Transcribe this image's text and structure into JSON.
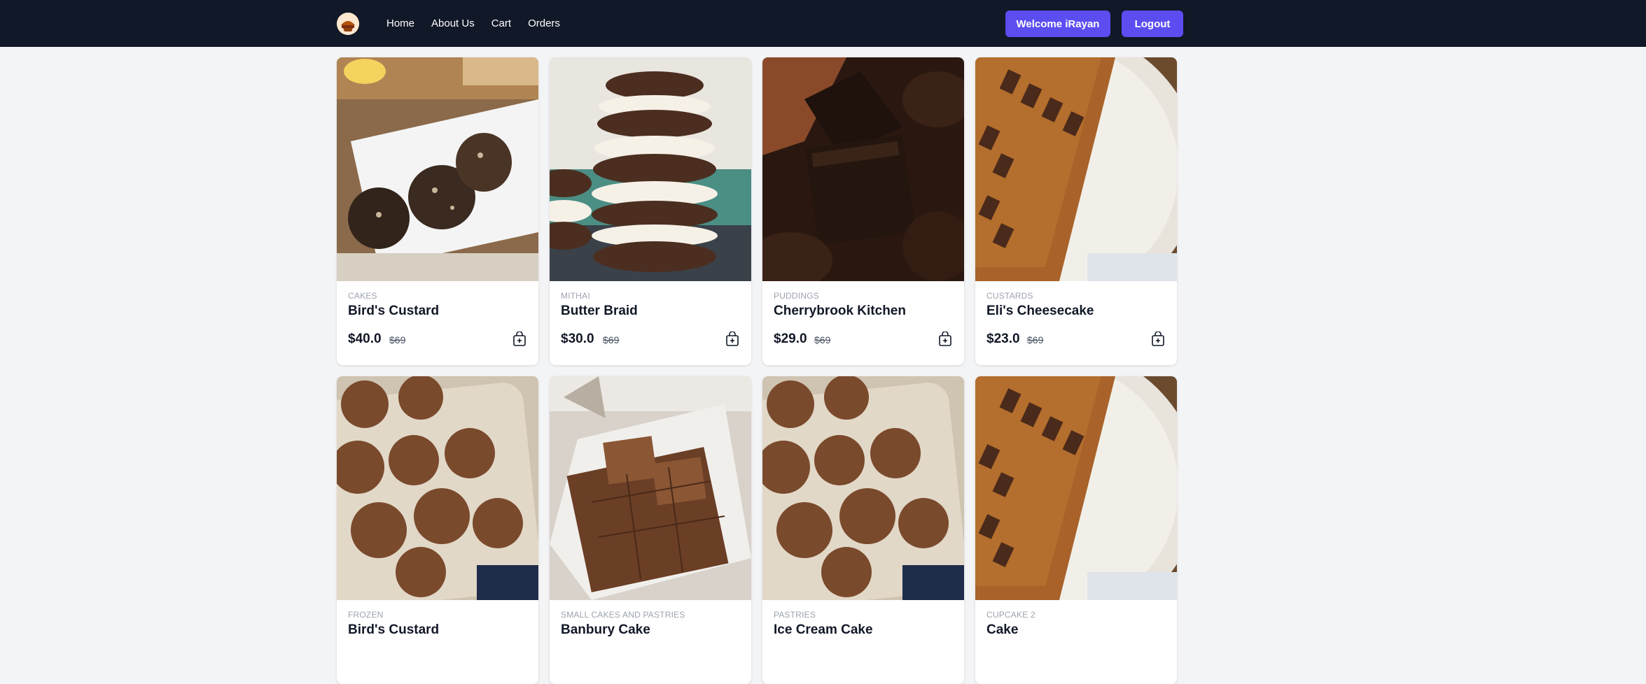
{
  "nav": {
    "links": [
      "Home",
      "About Us",
      "Cart",
      "Orders"
    ],
    "welcome_label": "Welcome iRayan",
    "logout_label": "Logout"
  },
  "colors": {
    "navbar_bg": "#111827",
    "button_accent": "#5b4df0",
    "page_bg": "#f3f4f6"
  },
  "products": [
    {
      "category": "CAKES",
      "name": "Bird's Custard",
      "price": "$40.0",
      "old_price": "$69",
      "image": "chocolate-salami-slices"
    },
    {
      "category": "MITHAI",
      "name": "Butter Braid",
      "price": "$30.0",
      "old_price": "$69",
      "image": "chocolate-cookie-sandwich-stack"
    },
    {
      "category": "PUDDINGS",
      "name": "Cherrybrook Kitchen",
      "price": "$29.0",
      "old_price": "$69",
      "image": "chocolate-brownie"
    },
    {
      "category": "CUSTARDS",
      "name": "Eli's Cheesecake",
      "price": "$23.0",
      "old_price": "$69",
      "image": "chocolate-kunafa-plate"
    },
    {
      "category": "FROZEN",
      "name": "Bird's Custard",
      "price": "",
      "old_price": "",
      "image": "chocolate-truffle-balls"
    },
    {
      "category": "SMALL CAKES AND PASTRIES",
      "name": "Banbury Cake",
      "price": "",
      "old_price": "",
      "image": "chocolate-caramel-slices"
    },
    {
      "category": "PASTRIES",
      "name": "Ice Cream Cake",
      "price": "",
      "old_price": "",
      "image": "chocolate-truffle-balls"
    },
    {
      "category": "CUPCAKE 2",
      "name": "Cake",
      "price": "",
      "old_price": "",
      "image": "chocolate-kunafa-plate"
    }
  ]
}
